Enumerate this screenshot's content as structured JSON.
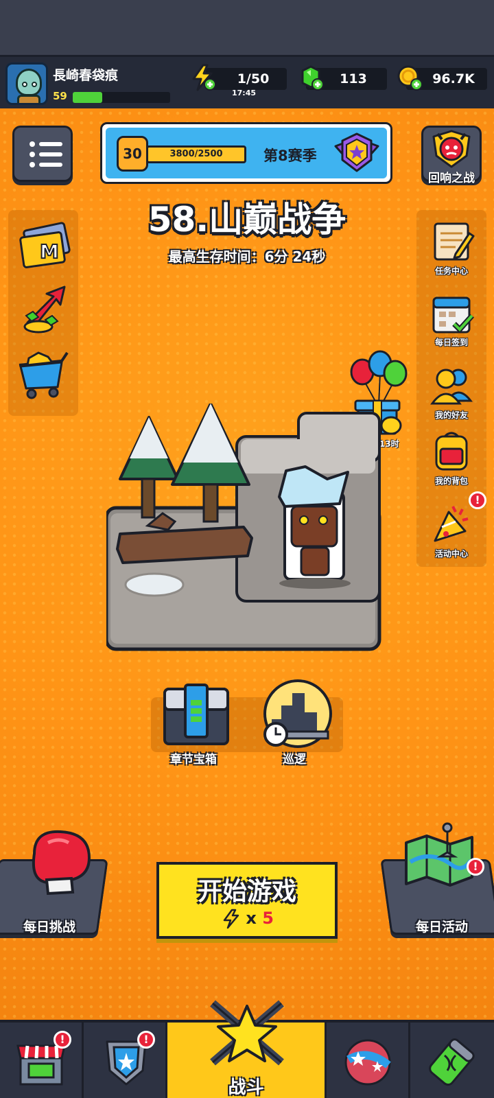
{
  "player": {
    "name": "長崎春袋痕",
    "level": "59",
    "xp_fraction": 0.3
  },
  "resources": {
    "energy": "1/50",
    "energy_timer": "17:45",
    "gems": "113",
    "coins": "96.7K"
  },
  "season": {
    "level": "30",
    "progress": "3800/2500",
    "title": "第8赛季"
  },
  "echo_battle": {
    "label": "回响之战"
  },
  "stage": {
    "title": "58.山巅战争",
    "best_time": "最高生存时间：6分 24秒"
  },
  "right_menu": [
    {
      "label": "任务中心",
      "icon": "quest-scroll-icon"
    },
    {
      "label": "每日签到",
      "icon": "calendar-check-icon"
    },
    {
      "label": "我的好友",
      "icon": "friends-icon"
    },
    {
      "label": "我的背包",
      "icon": "backpack-icon"
    },
    {
      "label": "活动中心",
      "icon": "party-popper-icon"
    }
  ],
  "left_menu": [
    {
      "icon": "m-card-icon"
    },
    {
      "icon": "growth-arrow-icon"
    },
    {
      "icon": "shop-cart-icon"
    }
  ],
  "gift": {
    "timer": "02天 13时"
  },
  "chapter_chest": {
    "label": "章节宝箱"
  },
  "patrol": {
    "label": "巡逻"
  },
  "daily_challenge": {
    "label": "每日挑战"
  },
  "daily_event": {
    "label": "每日活动"
  },
  "start_button": {
    "label": "开始游戏",
    "cost_prefix": "x",
    "cost": "5"
  },
  "bottom_nav": {
    "battle_label": "战斗"
  },
  "colors": {
    "background": "#ff9416",
    "start_button": "#ffe21f",
    "alert": "#e8223a",
    "xp_fill": "#4fd23a"
  }
}
